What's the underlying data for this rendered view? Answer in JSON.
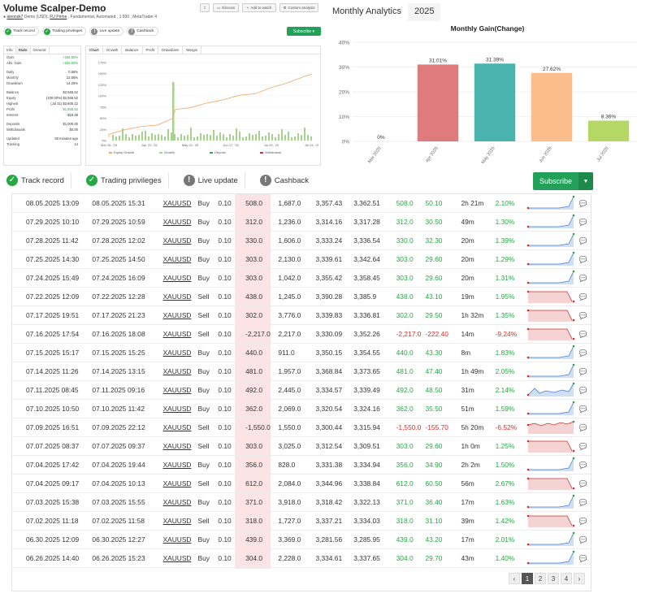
{
  "header": {
    "title": "Volume Scalper-Demo",
    "author": "aleonsk7",
    "subtitle_mid": "Demo (USD),",
    "broker": "FU Prime",
    "subtitle_rest": ", Fundamental, Automated , 1:500 , MetaTrader 4",
    "buttons": [
      "Discuss",
      "Add to watch",
      "Custom analysis"
    ],
    "small_subscribe": "Subscribe"
  },
  "badges": [
    {
      "label": "Track record",
      "ok": true
    },
    {
      "label": "Trading privileges",
      "ok": true
    },
    {
      "label": "Live update",
      "ok": false
    },
    {
      "label": "Cashback",
      "ok": false
    }
  ],
  "left_panel": {
    "tabs": [
      "Info",
      "Stats",
      "General"
    ],
    "rows": [
      {
        "k": "Gain:",
        "v": "+156.50%",
        "g": true
      },
      {
        "k": "Abs. Gain:",
        "v": "+156.50%",
        "g": true
      },
      {
        "k": "Daily",
        "v": "0.56%"
      },
      {
        "k": "Monthly",
        "v": "22.56%"
      },
      {
        "k": "Drawdown",
        "v": "14.25%"
      },
      {
        "k": "Balance",
        "v": "$2,565.52"
      },
      {
        "k": "Equity",
        "v": "(100.00%) $2,565.52"
      },
      {
        "k": "Highest",
        "v": "(Jul 31) $2,605.12"
      },
      {
        "k": "Profit",
        "v": "$1,565.52",
        "g": true
      },
      {
        "k": "Interest",
        "v": "-$18.48"
      },
      {
        "k": "Deposits",
        "v": "$1,000.00"
      },
      {
        "k": "Withdrawals",
        "v": "$0.00"
      },
      {
        "k": "Updated",
        "v": "50 minutes ago"
      },
      {
        "k": "Tracking",
        "v": "14"
      }
    ]
  },
  "mid_panel": {
    "tabs": [
      "Chart",
      "Growth",
      "Balance",
      "Profit",
      "Drawdown",
      "Margin"
    ],
    "x_labels": [
      "Mar 26, '25",
      "Apr 22, '25",
      "May 22, '25",
      "Jun 17, '25",
      "Jul 09, '25",
      "Jul 24, '25"
    ],
    "y_labels": [
      "175%",
      "150%",
      "125%",
      "100%",
      "75%",
      "50%",
      "25%",
      "0%"
    ],
    "legend": [
      "Equity Growth",
      "Growth",
      "Deposit",
      "Withdrawal"
    ]
  },
  "right_tabs": [
    "Monthly Analytics",
    "2025"
  ],
  "chart_data": {
    "type": "bar",
    "title": "Monthly Gain(Change)",
    "categories": [
      "Mar 2025",
      "Apr 2025",
      "May 2025",
      "Jun 2025",
      "Jul 2025"
    ],
    "values": [
      0,
      31.01,
      31.39,
      27.62,
      8.36
    ],
    "labels": [
      "0%",
      "31.01%",
      "31.39%",
      "27.62%",
      "8.36%"
    ],
    "colors": [
      "#e07b7b",
      "#e07b7b",
      "#4bb3ad",
      "#fbbd8c",
      "#b4d766"
    ],
    "yticks": [
      "40%",
      "30%",
      "20%",
      "10%",
      "0%"
    ],
    "ylim": [
      0,
      40
    ]
  },
  "big_subscribe": "Subscribe",
  "trades": [
    [
      "08.05.2025 13:09",
      "08.05.2025 15:31",
      "XAUUSD",
      "Buy",
      "0.10",
      "508.0",
      "1,687.0",
      "3,357.43",
      "3,362.51",
      "508.0",
      "50.10",
      "2h 21m",
      "2.10%",
      "up"
    ],
    [
      "07.29.2025 10:10",
      "07.29.2025 10:59",
      "XAUUSD",
      "Buy",
      "0.10",
      "312.0",
      "1,236.0",
      "3,314.16",
      "3,317.28",
      "312.0",
      "30.50",
      "49m",
      "1.30%",
      "up"
    ],
    [
      "07.28.2025 11:42",
      "07.28.2025 12:02",
      "XAUUSD",
      "Buy",
      "0.10",
      "330.0",
      "1,606.0",
      "3,333.24",
      "3,336.54",
      "330.0",
      "32.30",
      "20m",
      "1.39%",
      "up"
    ],
    [
      "07.25.2025 14:30",
      "07.25.2025 14:50",
      "XAUUSD",
      "Buy",
      "0.10",
      "303.0",
      "2,130.0",
      "3,339.61",
      "3,342.64",
      "303.0",
      "29.60",
      "20m",
      "1.29%",
      "up"
    ],
    [
      "07.24.2025 15:49",
      "07.24.2025 16:09",
      "XAUUSD",
      "Buy",
      "0.10",
      "303.0",
      "1,042.0",
      "3,355.42",
      "3,358.45",
      "303.0",
      "29.60",
      "20m",
      "1.31%",
      "up"
    ],
    [
      "07.22.2025 12:09",
      "07.22.2025 12:28",
      "XAUUSD",
      "Sell",
      "0.10",
      "438.0",
      "1,245.0",
      "3,390.28",
      "3,385.9",
      "438.0",
      "43.10",
      "19m",
      "1.95%",
      "down"
    ],
    [
      "07.17.2025 19:51",
      "07.17.2025 21:23",
      "XAUUSD",
      "Sell",
      "0.10",
      "302.0",
      "3,776.0",
      "3,339.83",
      "3,336.81",
      "302.0",
      "29.50",
      "1h 32m",
      "1.35%",
      "down"
    ],
    [
      "07.16.2025 17:54",
      "07.16.2025 18:08",
      "XAUUSD",
      "Sell",
      "0.10",
      "-2,217.0",
      "2,217.0",
      "3,330.09",
      "3,352.26",
      "-2,217.0",
      "-222.40",
      "14m",
      "-9.24%",
      "down"
    ],
    [
      "07.15.2025 15:17",
      "07.15.2025 15:25",
      "XAUUSD",
      "Buy",
      "0.10",
      "440.0",
      "911.0",
      "3,350.15",
      "3,354.55",
      "440.0",
      "43.30",
      "8m",
      "1.83%",
      "up"
    ],
    [
      "07.14.2025 11:26",
      "07.14.2025 13:15",
      "XAUUSD",
      "Buy",
      "0.10",
      "481.0",
      "1,957.0",
      "3,368.84",
      "3,373.65",
      "481.0",
      "47.40",
      "1h 49m",
      "2.05%",
      "up"
    ],
    [
      "07.11.2025 08:45",
      "07.11.2025 09:16",
      "XAUUSD",
      "Buy",
      "0.10",
      "492.0",
      "2,445.0",
      "3,334.57",
      "3,339.49",
      "492.0",
      "48.50",
      "31m",
      "2.14%",
      "wave"
    ],
    [
      "07.10.2025 10:50",
      "07.10.2025 11:42",
      "XAUUSD",
      "Buy",
      "0.10",
      "362.0",
      "2,069.0",
      "3,320.54",
      "3,324.16",
      "362.0",
      "35.50",
      "51m",
      "1.59%",
      "up"
    ],
    [
      "07.09.2025 16:51",
      "07.09.2025 22:12",
      "XAUUSD",
      "Sell",
      "0.10",
      "-1,550.0",
      "1,550.0",
      "3,300.44",
      "3,315.94",
      "-1,550.0",
      "-155.70",
      "5h 20m",
      "-6.52%",
      "flat"
    ],
    [
      "07.07.2025 08:37",
      "07.07.2025 09:37",
      "XAUUSD",
      "Sell",
      "0.10",
      "303.0",
      "3,025.0",
      "3,312.54",
      "3,309.51",
      "303.0",
      "29.60",
      "1h 0m",
      "1.25%",
      "down"
    ],
    [
      "07.04.2025 17:42",
      "07.04.2025 19:44",
      "XAUUSD",
      "Buy",
      "0.10",
      "356.0",
      "828.0",
      "3,331.38",
      "3,334.94",
      "356.0",
      "34.90",
      "2h 2m",
      "1.50%",
      "up"
    ],
    [
      "07.04.2025 09:17",
      "07.04.2025 10:13",
      "XAUUSD",
      "Sell",
      "0.10",
      "612.0",
      "2,084.0",
      "3,344.96",
      "3,338.84",
      "612.0",
      "60.50",
      "56m",
      "2.67%",
      "down"
    ],
    [
      "07.03.2025 15:38",
      "07.03.2025 15:55",
      "XAUUSD",
      "Buy",
      "0.10",
      "371.0",
      "3,918.0",
      "3,318.42",
      "3,322.13",
      "371.0",
      "36.40",
      "17m",
      "1.63%",
      "up"
    ],
    [
      "07.02.2025 11:18",
      "07.02.2025 11:58",
      "XAUUSD",
      "Sell",
      "0.10",
      "318.0",
      "1,727.0",
      "3,337.21",
      "3,334.03",
      "318.0",
      "31.10",
      "39m",
      "1.42%",
      "down"
    ],
    [
      "06.30.2025 12:09",
      "06.30.2025 12:27",
      "XAUUSD",
      "Buy",
      "0.10",
      "439.0",
      "3,369.0",
      "3,281.56",
      "3,285.95",
      "439.0",
      "43.20",
      "17m",
      "2.01%",
      "up"
    ],
    [
      "06.26.2025 14:40",
      "06.26.2025 15:23",
      "XAUUSD",
      "Buy",
      "0.10",
      "304.0",
      "2,228.0",
      "3,334.61",
      "3,337.65",
      "304.0",
      "29.70",
      "43m",
      "1.40%",
      "up"
    ]
  ],
  "pager": {
    "prev": "‹",
    "pages": [
      "1",
      "2",
      "3",
      "4"
    ],
    "active": "1",
    "next": "›"
  }
}
